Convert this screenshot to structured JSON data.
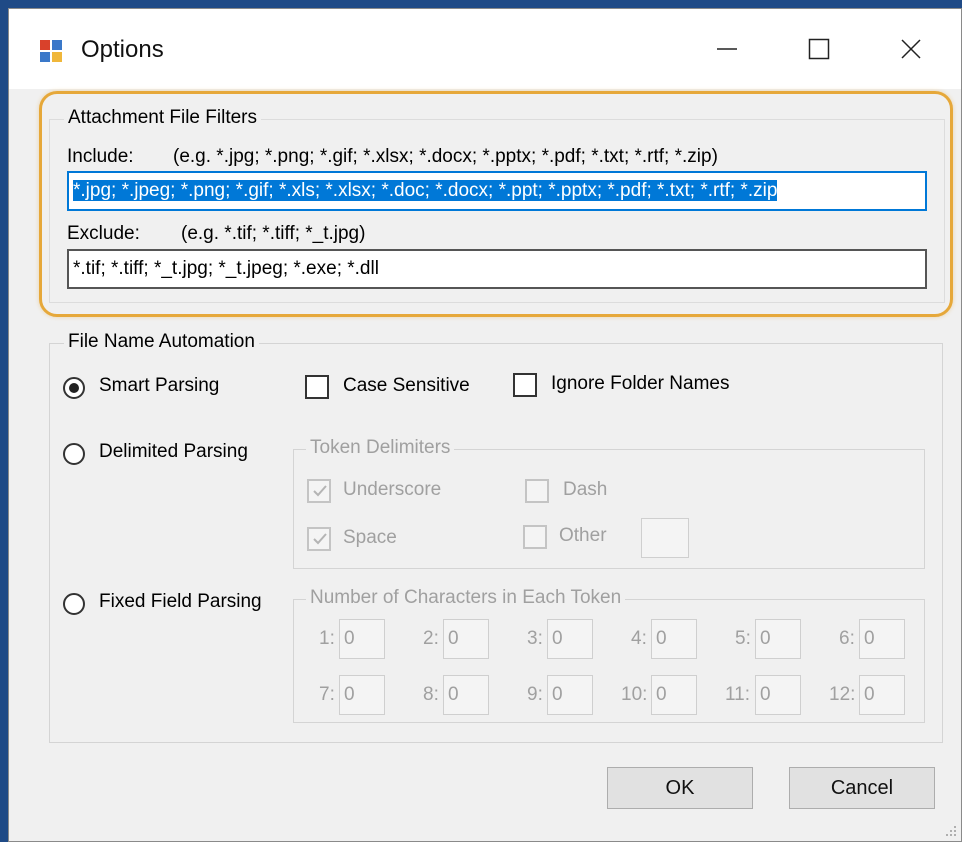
{
  "window": {
    "title": "Options",
    "app_icon": "options-app-icon"
  },
  "filters": {
    "group_title": "Attachment File Filters",
    "include_label": "Include:",
    "include_example": "(e.g. *.jpg; *.png; *.gif; *.xlsx; *.docx; *.pptx; *.pdf; *.txt; *.rtf; *.zip)",
    "include_value": "*.jpg; *.jpeg; *.png; *.gif; *.xls; *.xlsx; *.doc; *.docx; *.ppt; *.pptx; *.pdf; *.txt; *.rtf; *.zip",
    "exclude_label": "Exclude:",
    "exclude_example": "(e.g. *.tif; *.tiff; *_t.jpg)",
    "exclude_value": "*.tif; *.tiff; *_t.jpg; *_t.jpeg; *.exe; *.dll"
  },
  "automation": {
    "group_title": "File Name Automation",
    "smart_parsing": "Smart Parsing",
    "case_sensitive": "Case Sensitive",
    "ignore_folder_names": "Ignore Folder Names",
    "delimited_parsing": "Delimited Parsing",
    "token_delimiters": {
      "title": "Token Delimiters",
      "underscore": "Underscore",
      "dash": "Dash",
      "space": "Space",
      "other": "Other"
    },
    "fixed_field_parsing": "Fixed Field Parsing",
    "chars_title": "Number of Characters in Each Token",
    "tokens": [
      {
        "label": "1:",
        "value": "0"
      },
      {
        "label": "2:",
        "value": "0"
      },
      {
        "label": "3:",
        "value": "0"
      },
      {
        "label": "4:",
        "value": "0"
      },
      {
        "label": "5:",
        "value": "0"
      },
      {
        "label": "6:",
        "value": "0"
      },
      {
        "label": "7:",
        "value": "0"
      },
      {
        "label": "8:",
        "value": "0"
      },
      {
        "label": "9:",
        "value": "0"
      },
      {
        "label": "10:",
        "value": "0"
      },
      {
        "label": "11:",
        "value": "0"
      },
      {
        "label": "12:",
        "value": "0"
      }
    ]
  },
  "buttons": {
    "ok": "OK",
    "cancel": "Cancel"
  },
  "colors": {
    "highlight": "#e6a83a",
    "selection": "#0078d7",
    "desktop": "#1f4a86"
  }
}
